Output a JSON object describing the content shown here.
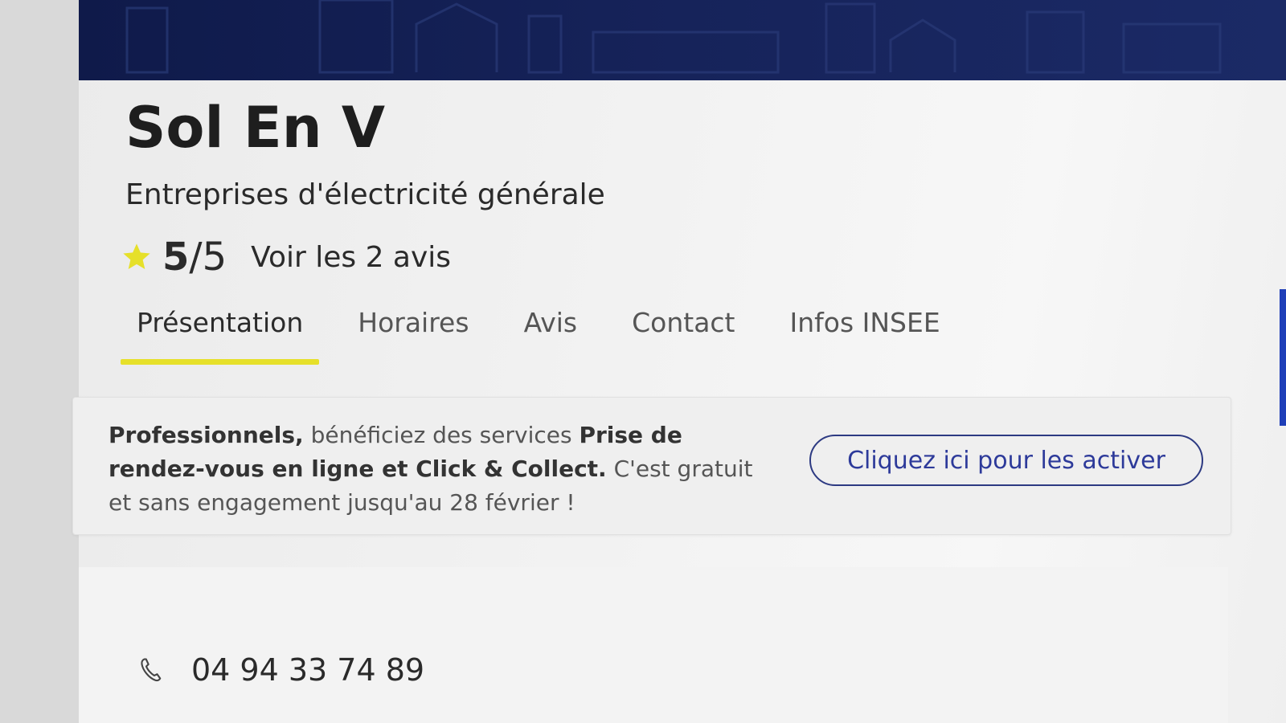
{
  "business": {
    "name": "Sol En V",
    "category": "Entreprises d'électricité générale"
  },
  "rating": {
    "score": "5",
    "scale": "/5",
    "reviews_link": "Voir les 2 avis",
    "star_icon": "star-icon",
    "star_color": "#e6e02a"
  },
  "tabs": [
    {
      "label": "Présentation",
      "active": true
    },
    {
      "label": "Horaires",
      "active": false
    },
    {
      "label": "Avis",
      "active": false
    },
    {
      "label": "Contact",
      "active": false
    },
    {
      "label": "Infos INSEE",
      "active": false
    }
  ],
  "promo": {
    "bold_1": "Professionnels,",
    "text_1": " bénéficiez des services ",
    "bold_2": "Prise de rendez-vous en ligne et Click & Collect.",
    "text_2": " C'est gratuit et sans engagement jusqu'au 28 février !",
    "button_label": "Cliquez ici pour les activer"
  },
  "contact": {
    "phone_icon": "phone-icon",
    "phone": "04 94 33 74 89"
  },
  "colors": {
    "banner": "#16235a",
    "accent_yellow": "#e6e02a",
    "button_blue": "#2d3a9a"
  }
}
